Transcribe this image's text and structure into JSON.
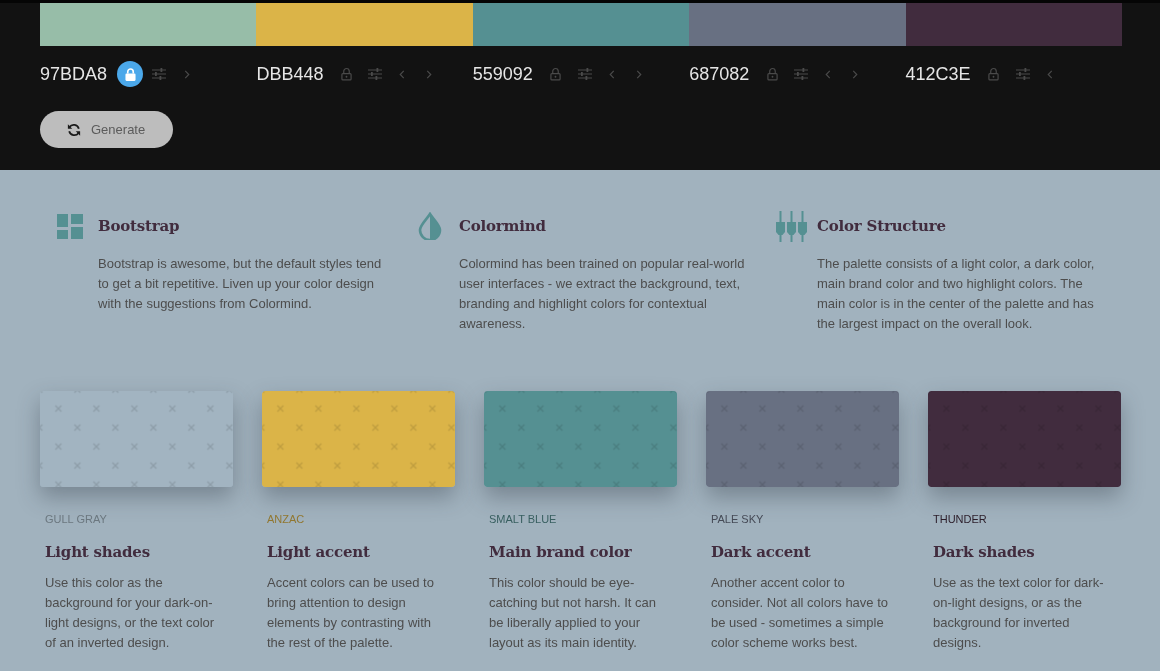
{
  "palette": [
    {
      "hex": "97BDA8",
      "color": "#97bda8",
      "locked": true
    },
    {
      "hex": "DBB448",
      "color": "#dbb448",
      "locked": false
    },
    {
      "hex": "559092",
      "color": "#559092",
      "locked": false
    },
    {
      "hex": "687082",
      "color": "#687082",
      "locked": false
    },
    {
      "hex": "412C3E",
      "color": "#412c3e",
      "locked": false
    }
  ],
  "generate_button": {
    "label": "Generate"
  },
  "features": [
    {
      "title": "Bootstrap",
      "description": "Bootstrap is awesome, but the default styles tend to get a bit repetitive. Liven up your color design with the suggestions from Colormind."
    },
    {
      "title": "Colormind",
      "description": "Colormind has been trained on popular real-world user interfaces - we extract the background, text, branding and highlight colors for contextual awareness."
    },
    {
      "title": "Color Structure",
      "description": "The palette consists of a light color, a dark color, main brand color and two highlight colors. The main color is in the center of the palette and has the largest impact on the overall look."
    }
  ],
  "roles": [
    {
      "color_name": "GULL GRAY",
      "color": "#a2b4c1",
      "title": "Light shades",
      "description": "Use this color as the background for your dark-on-light designs, or the text color of an inverted design."
    },
    {
      "color_name": "ANZAC",
      "color": "#dbb448",
      "title": "Light accent",
      "description": "Accent colors can be used to bring attention to design elements by contrasting with the rest of the palette."
    },
    {
      "color_name": "SMALT BLUE",
      "color": "#559092",
      "title": "Main brand color",
      "description": "This color should be eye-catching but not harsh. It can be liberally applied to your layout as its main identity."
    },
    {
      "color_name": "PALE SKY",
      "color": "#687082",
      "title": "Dark accent",
      "description": "Another accent color to consider. Not all colors have to be used - sometimes a simple color scheme works best."
    },
    {
      "color_name": "THUNDER",
      "color": "#412c3e",
      "title": "Dark shades",
      "description": "Use as the text color for dark-on-light designs, or as the background for inverted designs."
    }
  ]
}
